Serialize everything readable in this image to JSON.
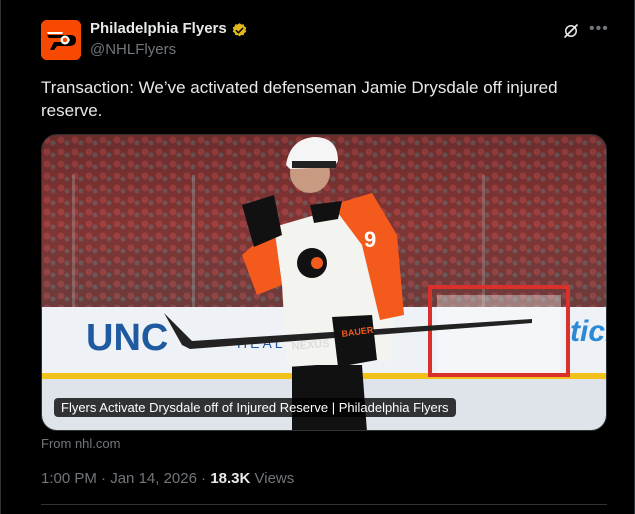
{
  "author": {
    "name": "Philadelphia Flyers",
    "handle": "@NHLFlyers",
    "avatar_icon": "flyers-logo",
    "verified_icon": "verified-badge-icon",
    "verified_color": "#e2b719"
  },
  "tweet": {
    "text": "Transaction: We’ve activated defenseman Jamie Drysdale off injured reserve."
  },
  "link_card": {
    "caption": "Flyers Activate Drysdale off of Injured Reserve | Philadelphia Flyers",
    "source": "From nhl.com",
    "jersey_number": "9",
    "board_text_left": "UNC",
    "board_text_mid": "HEALTH",
    "board_text_right": "tick",
    "stick_brand": "BAUER",
    "stick_model": "NEXUS"
  },
  "meta": {
    "time": "1:00 PM",
    "separator": "·",
    "date": "Jan 14, 2026",
    "views_count": "18.3K",
    "views_label": "Views"
  },
  "colors": {
    "background": "#000000",
    "text": "#e7e9ea",
    "muted": "#71767b",
    "flyers_orange": "#f74902"
  }
}
